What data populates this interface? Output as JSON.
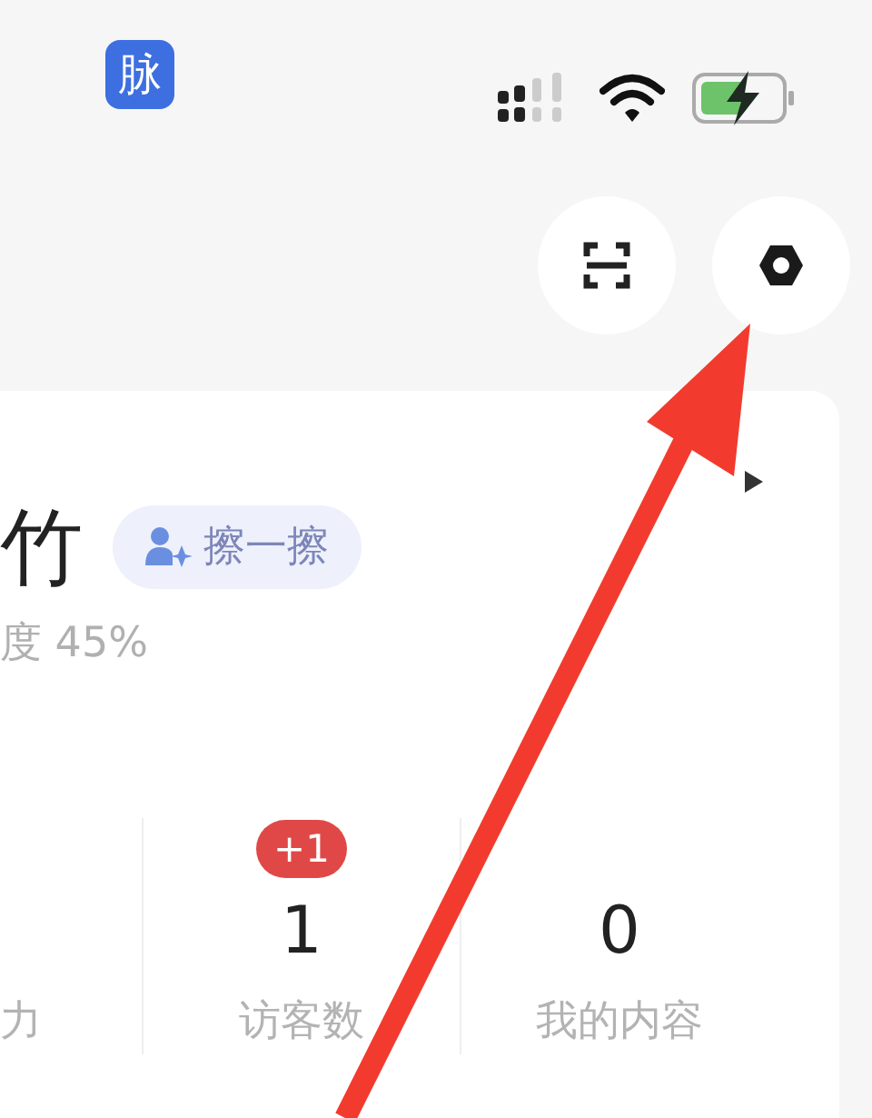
{
  "status_bar": {
    "app_icon": "脉"
  },
  "header_actions": [
    {
      "kind": "scan"
    },
    {
      "kind": "settings"
    }
  ],
  "profile": {
    "name": "竹",
    "action": "擦一擦",
    "progress": "度 45%"
  },
  "stats": [
    {
      "label": "力"
    },
    {
      "value": "1",
      "label": "访客数",
      "badge": "+1"
    },
    {
      "value": "0",
      "label": "我的内容"
    }
  ],
  "annotation": {
    "kind": "arrow"
  }
}
